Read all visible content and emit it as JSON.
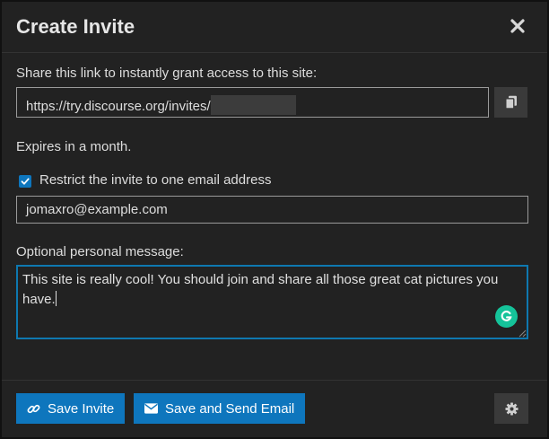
{
  "modal": {
    "title": "Create Invite",
    "close_icon": "close-icon"
  },
  "share": {
    "label": "Share this link to instantly grant access to this site:",
    "link_value": "https://try.discourse.org/invites/",
    "copy_icon": "copy-icon"
  },
  "expiry": {
    "text": "Expires in a month."
  },
  "restrict": {
    "checked": true,
    "label": "Restrict the invite to one email address",
    "email_value": "jomaxro@example.com"
  },
  "message": {
    "label": "Optional personal message:",
    "value": "This site is really cool! You should join and share all those great cat pictures you have."
  },
  "footer": {
    "save_label": "Save Invite",
    "save_icon": "link-icon",
    "send_label": "Save and Send Email",
    "send_icon": "envelope-icon",
    "settings_icon": "gear-icon"
  },
  "colors": {
    "accent": "#0e76bd",
    "focus_border": "#0e78b0",
    "grammarly": "#15c39a",
    "background": "#222222"
  }
}
